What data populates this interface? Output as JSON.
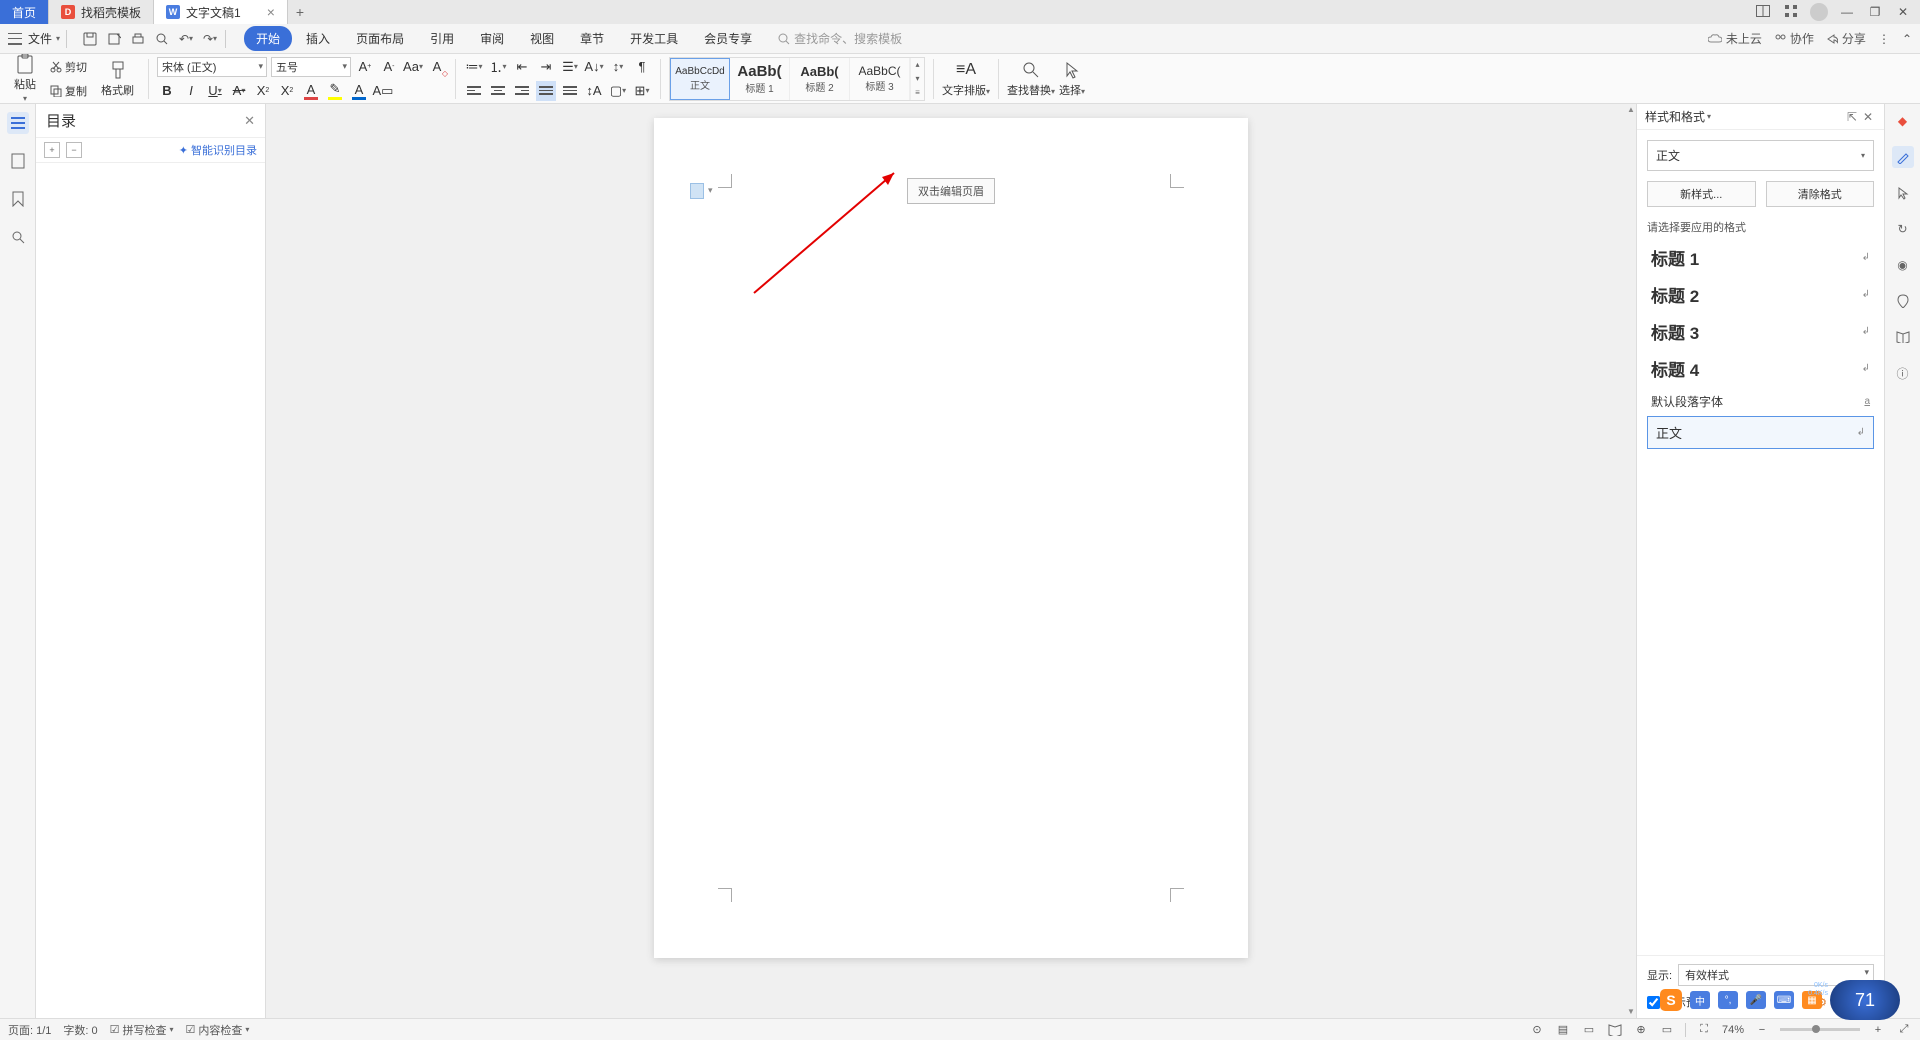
{
  "tabs": {
    "home": "首页",
    "template": "找稻壳模板",
    "doc": "文字文稿1"
  },
  "window": {
    "grid_icons": [
      "▦",
      "▦"
    ],
    "avatar": "◔"
  },
  "menubar": {
    "file": "文件",
    "ribbon_tabs": [
      "开始",
      "插入",
      "页面布局",
      "引用",
      "审阅",
      "视图",
      "章节",
      "开发工具",
      "会员专享"
    ],
    "search_placeholder": "查找命令、搜索模板",
    "cloud": "未上云",
    "collab": "协作",
    "share": "分享"
  },
  "ribbon": {
    "paste": "粘贴",
    "cut": "剪切",
    "copy": "复制",
    "format_painter": "格式刷",
    "font_name": "宋体 (正文)",
    "font_size": "五号",
    "styles": [
      {
        "preview": "AaBbCcDd",
        "label": "正文"
      },
      {
        "preview": "AaBb(",
        "label": "标题 1"
      },
      {
        "preview": "AaBb(",
        "label": "标题 2"
      },
      {
        "preview": "AaBbC(",
        "label": "标题 3"
      }
    ],
    "text_layout": "文字排版",
    "find_replace": "查找替换",
    "select": "选择"
  },
  "nav": {
    "title": "目录",
    "smart": "智能识别目录"
  },
  "page": {
    "header_hint": "双击编辑页眉"
  },
  "styles_panel": {
    "title": "样式和格式",
    "current": "正文",
    "new_style": "新样式...",
    "clear": "清除格式",
    "hint": "请选择要应用的格式",
    "list": [
      {
        "name": "标题 1",
        "h": true
      },
      {
        "name": "标题 2",
        "h": true
      },
      {
        "name": "标题 3",
        "h": true
      },
      {
        "name": "标题 4",
        "h": true
      },
      {
        "name": "默认段落字体",
        "h": false
      },
      {
        "name": "正文",
        "h": false
      }
    ],
    "show_label": "显示:",
    "show_value": "有效样式",
    "preview": "显示预览",
    "smart_layout": "智能排版"
  },
  "statusbar": {
    "page": "页面: 1/1",
    "words": "字数: 0",
    "spell": "拼写检查",
    "content": "内容检查",
    "zoom": "74%"
  },
  "overlay": {
    "ime": "中",
    "perf": "71"
  }
}
